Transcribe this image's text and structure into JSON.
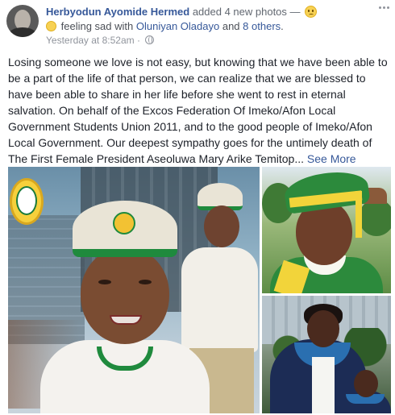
{
  "author": "Herbyodun Ayomide Hermed",
  "action": "added 4 new photos —",
  "feeling": {
    "prefix": "feeling sad with",
    "tagged_person": "Oluniyan Oladayo",
    "and": "and",
    "others": "8 others",
    "period": "."
  },
  "timestamp": "Yesterday at 8:52am",
  "timestamp_separator": "·",
  "post_text": "Losing someone we love is not easy, but knowing that we have been able to be a part of the life of that person, we can realize that we are blessed to have been able to share in her life before she went to rest in eternal salvation. On behalf of the Excos Federation Of Imeko/Afon Local Government Students Union 2011, and to the good people of Imeko/Afon Local Government. Our deepest sympathy goes for the untimely death of The First Female President Aseoluwa Mary Arike Temitop...",
  "see_more": "See More",
  "icons": {
    "emoji": "sad-face-icon",
    "feeling": "feeling-emoji-icon",
    "privacy": "globe-icon",
    "menu": "more-options-icon"
  },
  "colors": {
    "link": "#365899",
    "text": "#1d2129",
    "meta": "#90949c"
  }
}
